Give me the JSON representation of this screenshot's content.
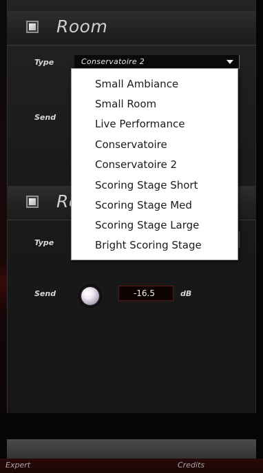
{
  "sections": [
    {
      "title": "Room",
      "type_label": "Type",
      "type_value": "Conservatoire 2",
      "send_label": "Send"
    },
    {
      "title": "Re",
      "type_label": "Type",
      "send_label": "Send",
      "send_value": "-16.5",
      "send_unit": "dB"
    }
  ],
  "dropdown": {
    "items": [
      "Small Ambiance",
      "Small Room",
      "Live Performance",
      "Conservatoire",
      "Conservatoire 2",
      "Scoring Stage Short",
      "Scoring Stage Med",
      "Scoring Stage Large",
      "Bright Scoring Stage"
    ]
  },
  "footer": {
    "expert_label": "Expert",
    "credits_label": "Credits"
  },
  "colors": {
    "value_box_border": "#5a1616",
    "dropdown_background": "#ffffff"
  }
}
